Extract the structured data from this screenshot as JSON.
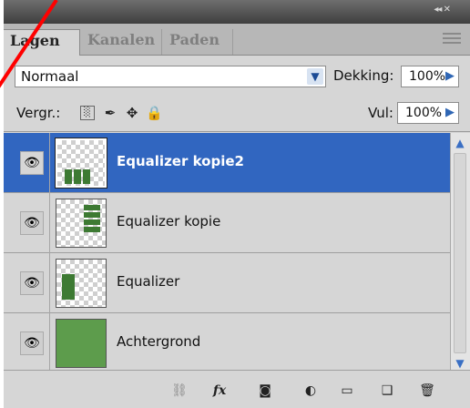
{
  "panel": {
    "collapse_glyph": "◂◂ ✕",
    "tabs": [
      {
        "label": "Lagen"
      },
      {
        "label": "Kanalen"
      },
      {
        "label": "Paden"
      }
    ]
  },
  "blend": {
    "mode": "Normaal",
    "opacity_label": "Dekking:",
    "opacity_value": "100%"
  },
  "lock": {
    "label": "Vergr.:",
    "fill_label": "Vul:",
    "fill_value": "100%"
  },
  "layers": [
    {
      "name": "Equalizer kopie2",
      "selected": true,
      "visible": true
    },
    {
      "name": "Equalizer kopie",
      "selected": false,
      "visible": true
    },
    {
      "name": "Equalizer",
      "selected": false,
      "visible": true
    },
    {
      "name": "Achtergrond",
      "selected": false,
      "visible": true
    }
  ],
  "colors": {
    "selection": "#3166c0",
    "thumb_green": "#5d9c4c",
    "annotation_red": "#ff0000"
  }
}
